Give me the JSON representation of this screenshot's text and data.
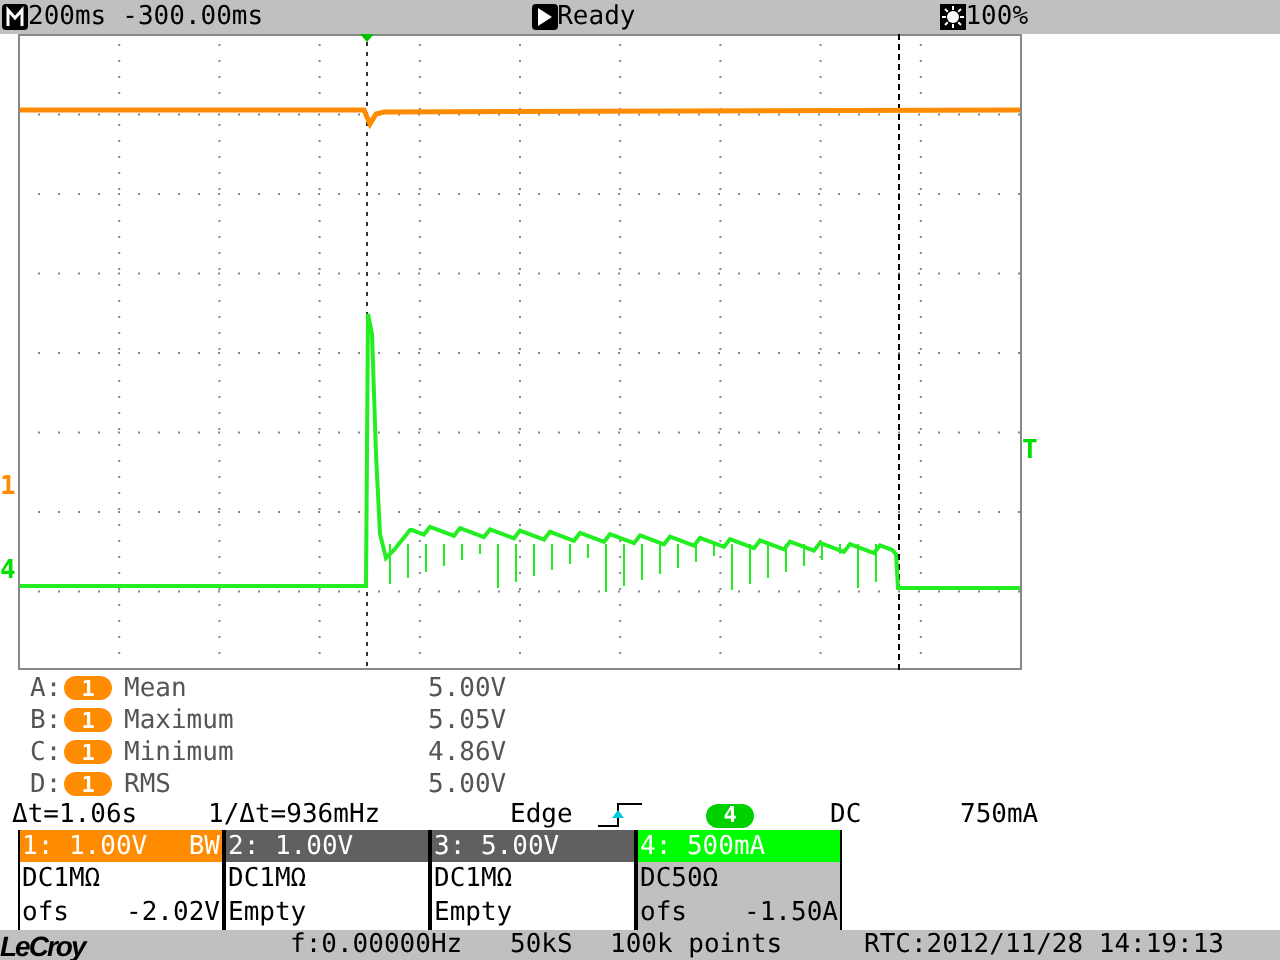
{
  "top_bar": {
    "timebase": "200ms",
    "delay": "-300.00ms",
    "status": "Ready",
    "intensity": "100%"
  },
  "scope": {
    "markers": [
      {
        "kind": "channel",
        "label": "1",
        "color": "#ff8c00"
      },
      {
        "kind": "channel",
        "label": "4",
        "color": "#00e000"
      },
      {
        "kind": "trigger",
        "label": "T",
        "color": "#00e000"
      }
    ]
  },
  "measurements": [
    {
      "letter": "A:",
      "channel": "1",
      "name": "Mean",
      "value": "5.00V"
    },
    {
      "letter": "B:",
      "channel": "1",
      "name": "Maximum",
      "value": "5.05V"
    },
    {
      "letter": "C:",
      "channel": "1",
      "name": "Minimum",
      "value": "4.86V"
    },
    {
      "letter": "D:",
      "channel": "1",
      "name": "RMS",
      "value": "5.00V"
    }
  ],
  "cursor": {
    "delta_t": "Δt=1.06s",
    "inverse": "1/Δt=936mHz"
  },
  "trigger": {
    "type": "Edge",
    "channel": "4",
    "coupling": "DC",
    "level": "750mA"
  },
  "channels": [
    {
      "header": "1: 1.00V",
      "bw": "BW",
      "color": "#ff8c00",
      "selected": false,
      "coupling": "DC1MΩ",
      "line3": "ofs",
      "line3_value": "-2.02V"
    },
    {
      "header": "2: 1.00V",
      "color": "#606060",
      "selected": false,
      "coupling": "DC1MΩ",
      "line3": "Empty"
    },
    {
      "header": "3: 5.00V",
      "color": "#606060",
      "selected": false,
      "coupling": "DC1MΩ",
      "line3": "Empty"
    },
    {
      "header": "4: 500mA",
      "color": "#00ff00",
      "selected": true,
      "coupling": "DC50Ω",
      "line3": "ofs",
      "line3_value": "-1.50A"
    }
  ],
  "status_bar": {
    "logo": "LeCroy",
    "frequency": "f:0.00000Hz",
    "sample_rate": "50kS",
    "points": "100k points",
    "rtc": "RTC:2012/11/28 14:19:13"
  }
}
